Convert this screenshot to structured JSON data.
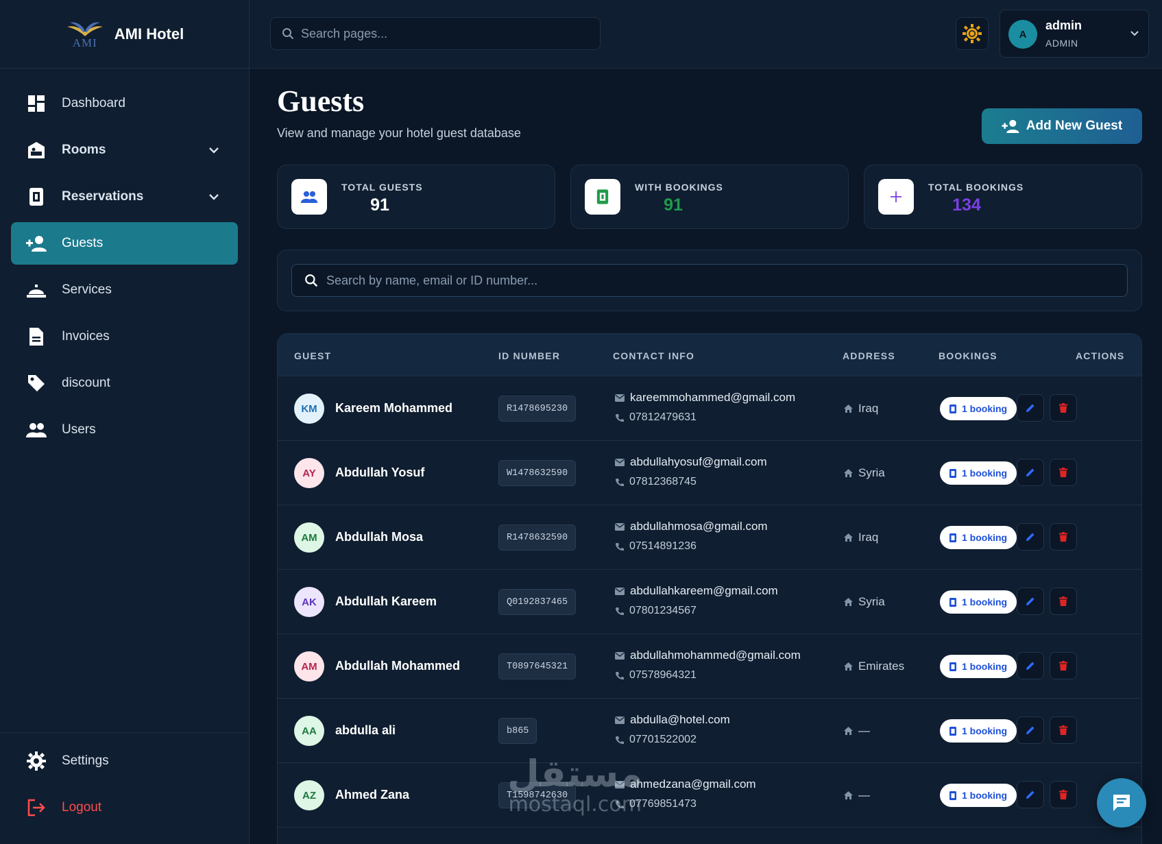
{
  "brand": {
    "logo_text": "AMI",
    "name": "AMI Hotel"
  },
  "sidebar": {
    "items": [
      {
        "label": "Dashboard",
        "icon": "dashboard-icon",
        "has_submenu": false,
        "active": false
      },
      {
        "label": "Rooms",
        "icon": "bed-icon",
        "has_submenu": true,
        "active": false
      },
      {
        "label": "Reservations",
        "icon": "calendar-book-icon",
        "has_submenu": true,
        "active": false
      },
      {
        "label": "Guests",
        "icon": "add-person-icon",
        "has_submenu": false,
        "active": true
      },
      {
        "label": "Services",
        "icon": "service-bell-icon",
        "has_submenu": false,
        "active": false
      },
      {
        "label": "Invoices",
        "icon": "document-icon",
        "has_submenu": false,
        "active": false
      },
      {
        "label": "discount",
        "icon": "tag-icon",
        "has_submenu": false,
        "active": false
      },
      {
        "label": "Users",
        "icon": "people-icon",
        "has_submenu": false,
        "active": false
      }
    ],
    "settings_label": "Settings",
    "logout_label": "Logout"
  },
  "topbar": {
    "search_placeholder": "Search pages...",
    "user": {
      "initial": "A",
      "name": "admin",
      "role": "ADMIN"
    }
  },
  "page": {
    "title": "Guests",
    "subtitle": "View and manage your hotel guest database",
    "add_button_label": "Add New Guest"
  },
  "stats": [
    {
      "label": "TOTAL GUESTS",
      "value": "91",
      "color": "#ffffff",
      "icon": "people-icon"
    },
    {
      "label": "WITH BOOKINGS",
      "value": "91",
      "color": "#1f9b4b",
      "icon": "booking-icon"
    },
    {
      "label": "TOTAL BOOKINGS",
      "value": "134",
      "color": "#7b3fe4",
      "icon": "plus-icon"
    }
  ],
  "table": {
    "search_placeholder": "Search by name, email or ID number...",
    "headers": {
      "guest": "GUEST",
      "id": "ID NUMBER",
      "contact": "CONTACT INFO",
      "address": "ADDRESS",
      "bookings": "BOOKINGS",
      "actions": "ACTIONS"
    },
    "rows": [
      {
        "initials": "KM",
        "name": "Kareem Mohammed",
        "id": "R1478695230",
        "email": "kareemmohammed@gmail.com",
        "phone": "07812479631",
        "address": "Iraq",
        "bookings": "1 booking",
        "avatar_bg": "#e3f1fb",
        "avatar_fg": "#1f6fb3"
      },
      {
        "initials": "AY",
        "name": "Abdullah Yosuf",
        "id": "W1478632590",
        "email": "abdullahyosuf@gmail.com",
        "phone": "07812368745",
        "address": "Syria",
        "bookings": "1 booking",
        "avatar_bg": "#fde5ec",
        "avatar_fg": "#b3264f"
      },
      {
        "initials": "AM",
        "name": "Abdullah Mosa",
        "id": "R1478632590",
        "email": "abdullahmosa@gmail.com",
        "phone": "07514891236",
        "address": "Iraq",
        "bookings": "1 booking",
        "avatar_bg": "#ddf6e5",
        "avatar_fg": "#1d7a3d"
      },
      {
        "initials": "AK",
        "name": "Abdullah Kareem",
        "id": "Q0192837465",
        "email": "abdullahkareem@gmail.com",
        "phone": "07801234567",
        "address": "Syria",
        "bookings": "1 booking",
        "avatar_bg": "#ece5fb",
        "avatar_fg": "#5b34b8"
      },
      {
        "initials": "AM",
        "name": "Abdullah Mohammed",
        "id": "T0897645321",
        "email": "abdullahmohammed@gmail.com",
        "phone": "07578964321",
        "address": "Emirates",
        "bookings": "1 booking",
        "avatar_bg": "#fde5ea",
        "avatar_fg": "#b3264f"
      },
      {
        "initials": "AA",
        "name": "abdulla ali",
        "id": "b865",
        "email": "abdulla@hotel.com",
        "phone": "07701522002",
        "address": "—",
        "bookings": "1 booking",
        "avatar_bg": "#ddf6e5",
        "avatar_fg": "#1d7a3d"
      },
      {
        "initials": "AZ",
        "name": "Ahmed Zana",
        "id": "T1598742630",
        "email": "ahmedzana@gmail.com",
        "phone": "07769851473",
        "address": "—",
        "bookings": "1 booking",
        "avatar_bg": "#ddf6e5",
        "avatar_fg": "#1d7a3d"
      }
    ]
  },
  "watermark": {
    "arabic": "مستقل",
    "latin": "mostaql.com"
  }
}
